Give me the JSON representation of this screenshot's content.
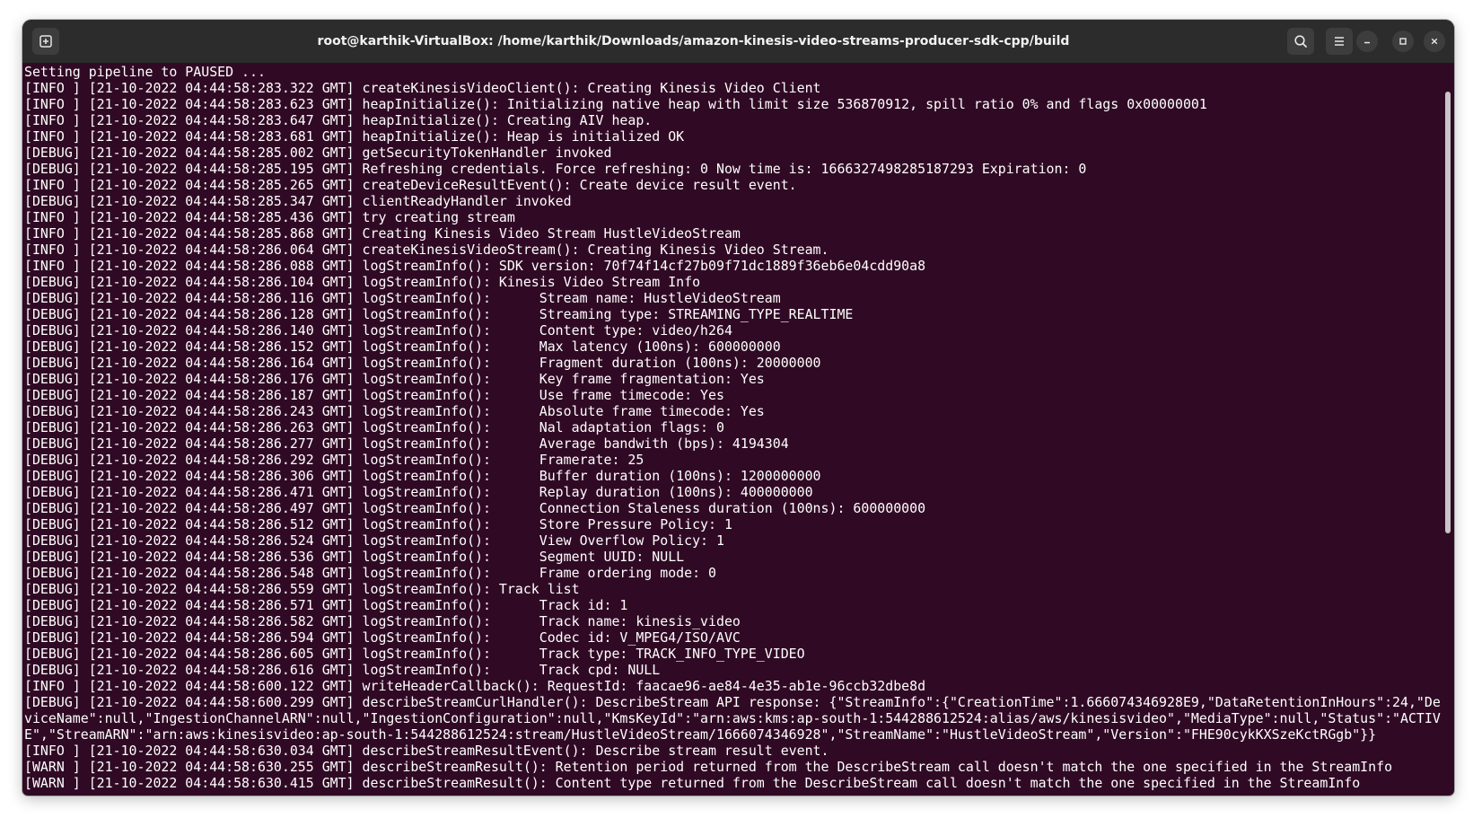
{
  "window": {
    "title": "root@karthik-VirtualBox: /home/karthik/Downloads/amazon-kinesis-video-streams-producer-sdk-cpp/build"
  },
  "icons": {
    "new_tab": "new-tab-icon",
    "search": "search-icon",
    "menu": "hamburger-menu-icon",
    "minimize": "minimize-icon",
    "maximize": "maximize-icon",
    "close": "close-icon"
  },
  "colors": {
    "terminal_background": "#300a24",
    "titlebar_background": "#2c2c2c",
    "text": "#ffffff"
  },
  "terminal": {
    "lines": [
      "Setting pipeline to PAUSED ...",
      "[INFO ] [21-10-2022 04:44:58:283.322 GMT] createKinesisVideoClient(): Creating Kinesis Video Client",
      "[INFO ] [21-10-2022 04:44:58:283.623 GMT] heapInitialize(): Initializing native heap with limit size 536870912, spill ratio 0% and flags 0x00000001",
      "[INFO ] [21-10-2022 04:44:58:283.647 GMT] heapInitialize(): Creating AIV heap.",
      "[INFO ] [21-10-2022 04:44:58:283.681 GMT] heapInitialize(): Heap is initialized OK",
      "[DEBUG] [21-10-2022 04:44:58:285.002 GMT] getSecurityTokenHandler invoked",
      "[DEBUG] [21-10-2022 04:44:58:285.195 GMT] Refreshing credentials. Force refreshing: 0 Now time is: 1666327498285187293 Expiration: 0",
      "[INFO ] [21-10-2022 04:44:58:285.265 GMT] createDeviceResultEvent(): Create device result event.",
      "[DEBUG] [21-10-2022 04:44:58:285.347 GMT] clientReadyHandler invoked",
      "[INFO ] [21-10-2022 04:44:58:285.436 GMT] try creating stream",
      "[INFO ] [21-10-2022 04:44:58:285.868 GMT] Creating Kinesis Video Stream HustleVideoStream",
      "[INFO ] [21-10-2022 04:44:58:286.064 GMT] createKinesisVideoStream(): Creating Kinesis Video Stream.",
      "[INFO ] [21-10-2022 04:44:58:286.088 GMT] logStreamInfo(): SDK version: 70f74f14cf27b09f71dc1889f36eb6e04cdd90a8",
      "[DEBUG] [21-10-2022 04:44:58:286.104 GMT] logStreamInfo(): Kinesis Video Stream Info",
      "[DEBUG] [21-10-2022 04:44:58:286.116 GMT] logStreamInfo():      Stream name: HustleVideoStream",
      "[DEBUG] [21-10-2022 04:44:58:286.128 GMT] logStreamInfo():      Streaming type: STREAMING_TYPE_REALTIME",
      "[DEBUG] [21-10-2022 04:44:58:286.140 GMT] logStreamInfo():      Content type: video/h264",
      "[DEBUG] [21-10-2022 04:44:58:286.152 GMT] logStreamInfo():      Max latency (100ns): 600000000",
      "[DEBUG] [21-10-2022 04:44:58:286.164 GMT] logStreamInfo():      Fragment duration (100ns): 20000000",
      "[DEBUG] [21-10-2022 04:44:58:286.176 GMT] logStreamInfo():      Key frame fragmentation: Yes",
      "[DEBUG] [21-10-2022 04:44:58:286.187 GMT] logStreamInfo():      Use frame timecode: Yes",
      "[DEBUG] [21-10-2022 04:44:58:286.243 GMT] logStreamInfo():      Absolute frame timecode: Yes",
      "[DEBUG] [21-10-2022 04:44:58:286.263 GMT] logStreamInfo():      Nal adaptation flags: 0",
      "[DEBUG] [21-10-2022 04:44:58:286.277 GMT] logStreamInfo():      Average bandwith (bps): 4194304",
      "[DEBUG] [21-10-2022 04:44:58:286.292 GMT] logStreamInfo():      Framerate: 25",
      "[DEBUG] [21-10-2022 04:44:58:286.306 GMT] logStreamInfo():      Buffer duration (100ns): 1200000000",
      "[DEBUG] [21-10-2022 04:44:58:286.471 GMT] logStreamInfo():      Replay duration (100ns): 400000000",
      "[DEBUG] [21-10-2022 04:44:58:286.497 GMT] logStreamInfo():      Connection Staleness duration (100ns): 600000000",
      "[DEBUG] [21-10-2022 04:44:58:286.512 GMT] logStreamInfo():      Store Pressure Policy: 1",
      "[DEBUG] [21-10-2022 04:44:58:286.524 GMT] logStreamInfo():      View Overflow Policy: 1",
      "[DEBUG] [21-10-2022 04:44:58:286.536 GMT] logStreamInfo():      Segment UUID: NULL",
      "[DEBUG] [21-10-2022 04:44:58:286.548 GMT] logStreamInfo():      Frame ordering mode: 0",
      "[DEBUG] [21-10-2022 04:44:58:286.559 GMT] logStreamInfo(): Track list",
      "[DEBUG] [21-10-2022 04:44:58:286.571 GMT] logStreamInfo():      Track id: 1",
      "[DEBUG] [21-10-2022 04:44:58:286.582 GMT] logStreamInfo():      Track name: kinesis_video",
      "[DEBUG] [21-10-2022 04:44:58:286.594 GMT] logStreamInfo():      Codec id: V_MPEG4/ISO/AVC",
      "[DEBUG] [21-10-2022 04:44:58:286.605 GMT] logStreamInfo():      Track type: TRACK_INFO_TYPE_VIDEO",
      "[DEBUG] [21-10-2022 04:44:58:286.616 GMT] logStreamInfo():      Track cpd: NULL",
      "[INFO ] [21-10-2022 04:44:58:600.122 GMT] writeHeaderCallback(): RequestId: faacae96-ae84-4e35-ab1e-96ccb32dbe8d",
      "[DEBUG] [21-10-2022 04:44:58:600.299 GMT] describeStreamCurlHandler(): DescribeStream API response: {\"StreamInfo\":{\"CreationTime\":1.666074346928E9,\"DataRetentionInHours\":24,\"DeviceName\":null,\"IngestionChannelARN\":null,\"IngestionConfiguration\":null,\"KmsKeyId\":\"arn:aws:kms:ap-south-1:544288612524:alias/aws/kinesisvideo\",\"MediaType\":null,\"Status\":\"ACTIVE\",\"StreamARN\":\"arn:aws:kinesisvideo:ap-south-1:544288612524:stream/HustleVideoStream/1666074346928\",\"StreamName\":\"HustleVideoStream\",\"Version\":\"FHE90cykKXSzeKctRGgb\"}}",
      "[INFO ] [21-10-2022 04:44:58:630.034 GMT] describeStreamResultEvent(): Describe stream result event.",
      "[WARN ] [21-10-2022 04:44:58:630.255 GMT] describeStreamResult(): Retention period returned from the DescribeStream call doesn't match the one specified in the StreamInfo",
      "[WARN ] [21-10-2022 04:44:58:630.415 GMT] describeStreamResult(): Content type returned from the DescribeStream call doesn't match the one specified in the StreamInfo"
    ]
  }
}
